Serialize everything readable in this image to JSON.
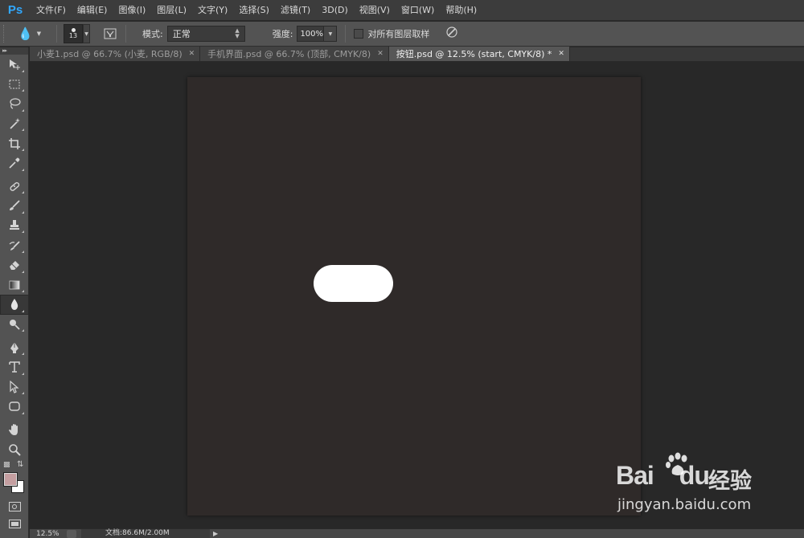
{
  "app": {
    "logo": "Ps"
  },
  "menu": [
    "文件(F)",
    "编辑(E)",
    "图像(I)",
    "图层(L)",
    "文字(Y)",
    "选择(S)",
    "滤镜(T)",
    "3D(D)",
    "视图(V)",
    "窗口(W)",
    "帮助(H)"
  ],
  "options": {
    "brush_size": "13",
    "mode_label": "模式:",
    "mode_value": "正常",
    "strength_label": "强度:",
    "strength_value": "100%",
    "sample_all_layers_label": "对所有图层取样",
    "sample_all_layers_checked": false
  },
  "tabs": [
    {
      "label": "小麦1.psd @ 66.7% (小麦, RGB/8)",
      "active": false
    },
    {
      "label": "手机界面.psd @ 66.7% (顶部, CMYK/8)",
      "active": false
    },
    {
      "label": "按钮.psd @ 12.5% (start, CMYK/8) *",
      "active": true
    }
  ],
  "tools": [
    "move-tool",
    "marquee-tool",
    "lasso-tool",
    "magic-wand-tool",
    "crop-tool",
    "eyedropper-tool",
    "healing-brush-tool",
    "brush-tool",
    "clone-stamp-tool",
    "history-brush-tool",
    "eraser-tool",
    "gradient-tool",
    "blur-tool",
    "dodge-tool",
    "pen-tool",
    "type-tool",
    "path-selection-tool",
    "shape-tool",
    "hand-tool",
    "zoom-tool"
  ],
  "colors": {
    "foreground": "#c49ea0",
    "background": "#ffffff",
    "canvas": "#2f2a29",
    "pill": "#ffffff"
  },
  "status": {
    "zoom": "12.5%",
    "doc": "文档:86.6M/2.00M"
  },
  "watermark": {
    "logo_text": "Bai",
    "logo_du": "du",
    "cn_text": "经验",
    "url": "jingyan.baidu.com"
  }
}
